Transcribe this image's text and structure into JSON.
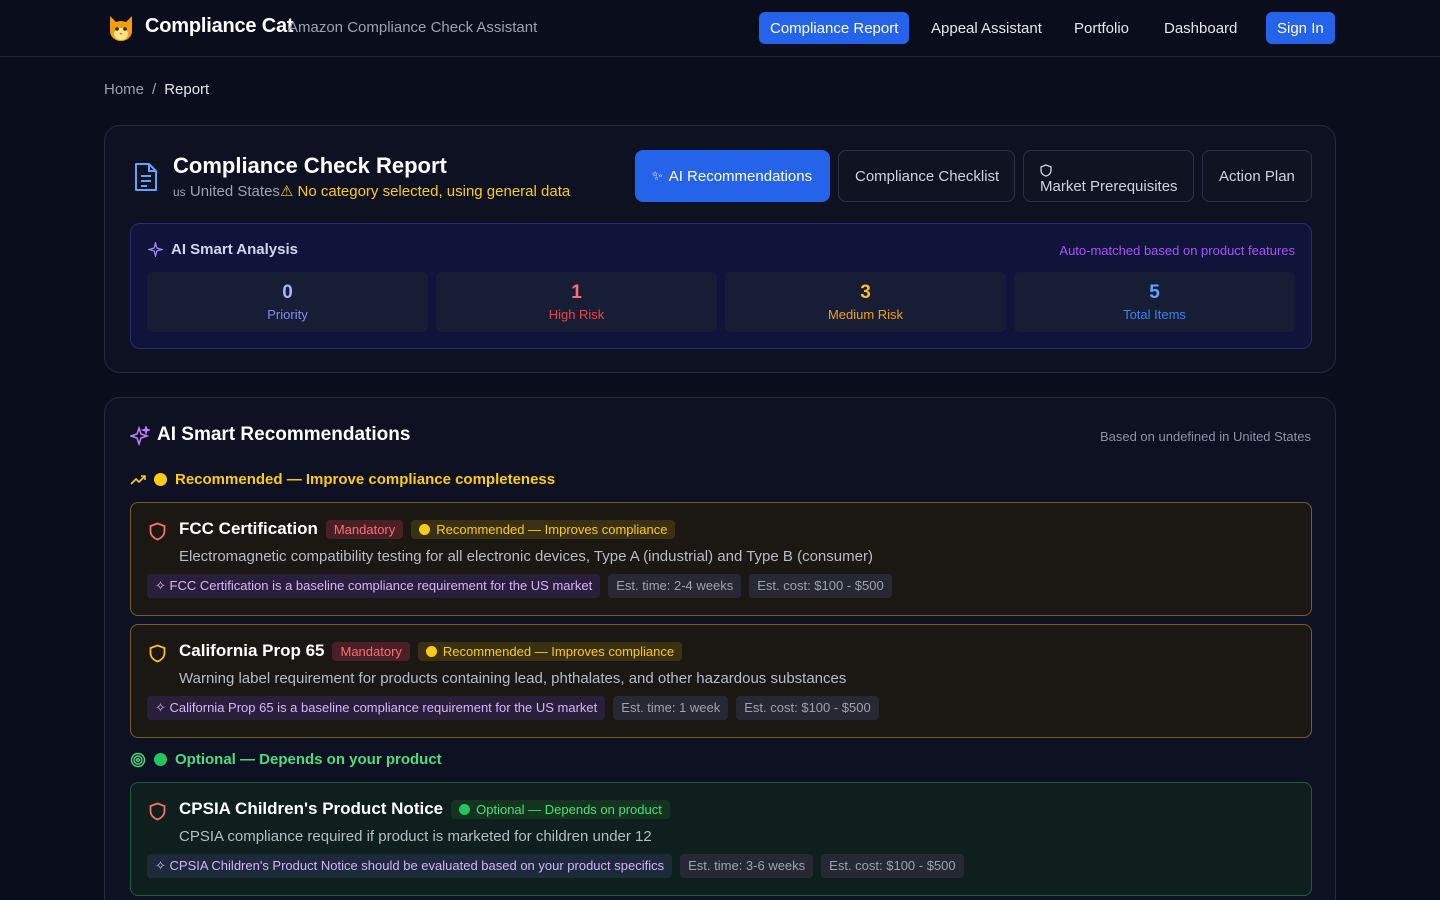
{
  "header": {
    "brand": "Compliance Cat",
    "tagline": "Amazon Compliance Check Assistant",
    "nav": [
      "Compliance Report",
      "Appeal Assistant",
      "Portfolio",
      "Dashboard"
    ],
    "sign_in": "Sign In",
    "logo_icon": "cat-icon"
  },
  "breadcrumb": {
    "home": "Home",
    "separator": "/",
    "current": "Report"
  },
  "report": {
    "title": "Compliance Check Report",
    "country_code": "us",
    "country": "United States",
    "warning": "⚠ No category selected, using general data",
    "tabs": {
      "ai": "AI Recommendations",
      "checklist": "Compliance Checklist",
      "prereq": "Market Prerequisites",
      "action": "Action Plan"
    }
  },
  "analysis": {
    "title": "AI Smart Analysis",
    "note": "Auto-matched based on product features",
    "stats": [
      {
        "value": "0",
        "label": "Priority",
        "color": "#a5b4fc"
      },
      {
        "value": "1",
        "label": "High Risk",
        "color": "#f87171"
      },
      {
        "value": "3",
        "label": "Medium Risk",
        "color": "#fbbf24"
      },
      {
        "value": "5",
        "label": "Total Items",
        "color": "#60a5fa"
      }
    ]
  },
  "recommendations": {
    "title": "AI Smart Recommendations",
    "note": "Based on undefined in United States",
    "group_recommended": "Recommended — Improve compliance completeness",
    "group_optional": "Optional — Depends on your product",
    "items": [
      {
        "name": "FCC Certification",
        "mandatory": "Mandatory",
        "status": "Recommended — Improves compliance",
        "desc": "Electromagnetic compatibility testing for all electronic devices, Type A (industrial) and Type B (consumer)",
        "reason": "FCC Certification is a baseline compliance requirement for the US market",
        "time": "Est. time: 2-4 weeks",
        "cost": "Est. cost: $100 - $500"
      },
      {
        "name": "California Prop 65",
        "mandatory": "Mandatory",
        "status": "Recommended — Improves compliance",
        "desc": "Warning label requirement for products containing lead, phthalates, and other hazardous substances",
        "reason": "California Prop 65 is a baseline compliance requirement for the US market",
        "time": "Est. time: 1 week",
        "cost": "Est. cost: $100 - $500"
      },
      {
        "name": "CPSIA Children's Product Notice",
        "status": "Optional — Depends on product",
        "desc": "CPSIA compliance required if product is marketed for children under 12",
        "reason": "CPSIA Children's Product Notice should be evaluated based on your product specifics",
        "time": "Est. time: 3-6 weeks",
        "cost": "Est. cost: $100 - $500"
      }
    ]
  },
  "colors": {
    "accent": "#2563eb",
    "recommended": "#facc15",
    "optional": "#22c55e",
    "mandatory": "#f87171"
  }
}
